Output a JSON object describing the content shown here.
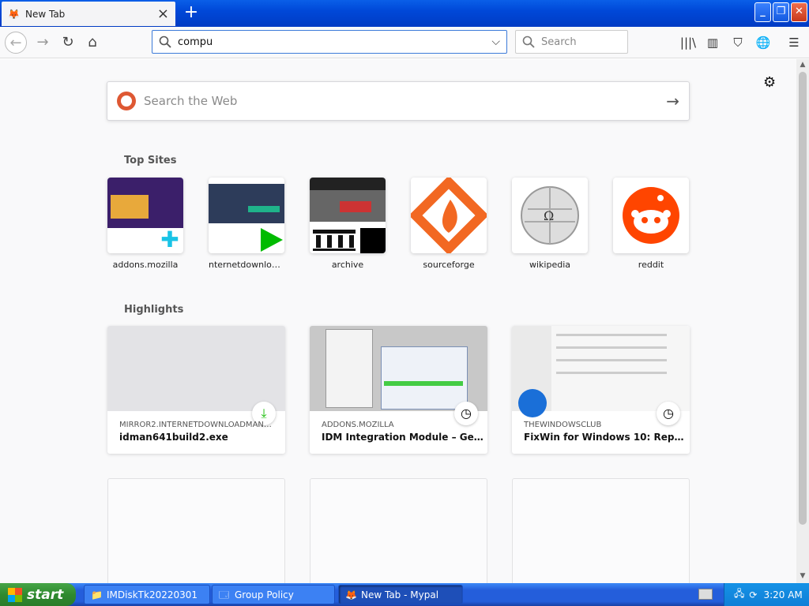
{
  "window": {
    "tab_title": "New Tab",
    "tab_close": "×",
    "new_tab": "+"
  },
  "toolbar": {
    "url_value": "compu",
    "search_placeholder": "Search"
  },
  "newtab": {
    "web_search_placeholder": "Search the Web",
    "top_sites_title": "Top Sites",
    "top_sites": [
      {
        "label": "addons.mozilla"
      },
      {
        "label": "nternetdownload..."
      },
      {
        "label": "archive"
      },
      {
        "label": "sourceforge"
      },
      {
        "label": "wikipedia"
      },
      {
        "label": "reddit"
      }
    ],
    "highlights_title": "Highlights",
    "highlights": [
      {
        "source": "MIRROR2.INTERNETDOWNLOADMANAGE...",
        "title": "idman641build2.exe",
        "badge_icon": "download-icon"
      },
      {
        "source": "ADDONS.MOZILLA",
        "title": "IDM Integration Module – Get t...",
        "badge_icon": "clock-icon"
      },
      {
        "source": "THEWINDOWSCLUB",
        "title": "FixWin for Windows 10: Repair p...",
        "badge_icon": "clock-icon"
      }
    ]
  },
  "taskbar": {
    "start_label": "start",
    "tasks": [
      {
        "label": "IMDiskTk20220301"
      },
      {
        "label": "Group Policy"
      },
      {
        "label": "New Tab - Mypal"
      }
    ],
    "clock": "3:20 AM"
  },
  "colors": {
    "accent": "#3d7bd9",
    "reddit": "#ff4500",
    "sourceforge": "#f26822",
    "ddg": "#de5833",
    "download_green": "#12bc00"
  }
}
